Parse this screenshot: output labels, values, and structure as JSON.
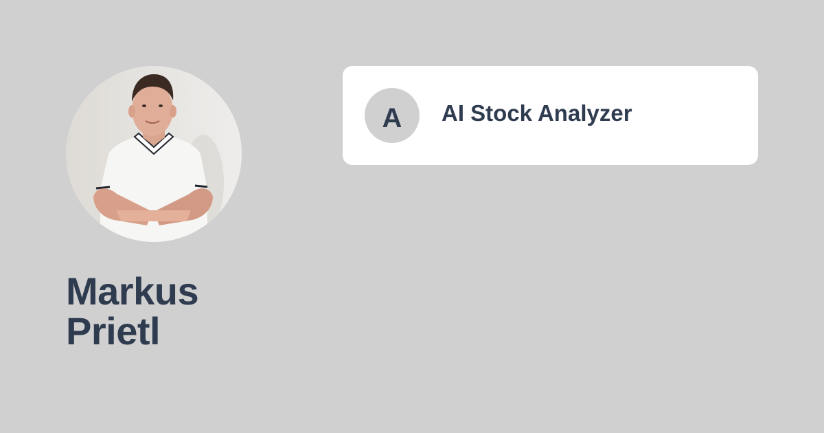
{
  "author": {
    "first_name": "Markus",
    "last_name": "Prietl"
  },
  "project": {
    "initial": "A",
    "title": "AI Stock Analyzer"
  },
  "colors": {
    "background": "#d0d0d0",
    "card": "#ffffff",
    "text": "#2f3b4f"
  }
}
